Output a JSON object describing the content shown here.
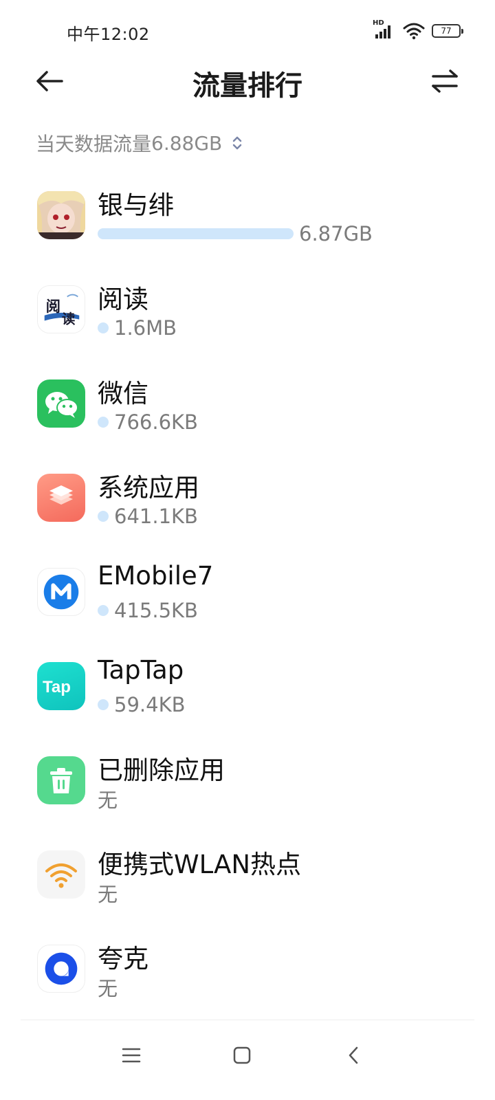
{
  "status_bar": {
    "time": "中午12:02",
    "network_label": "HD",
    "battery_level": "77",
    "signal_bars_of_4": 4,
    "wifi_connected": true
  },
  "header": {
    "title": "流量排行",
    "back_icon": "arrow-left-icon",
    "swap_icon": "swap-arrows-icon"
  },
  "summary": {
    "label": "当天数据流量",
    "value": "6.88GB",
    "chevron_icon": "chevron-up-down-icon"
  },
  "colors": {
    "usage_bar": "#cfe6fb",
    "secondary_text": "#7b7b7b",
    "title_text": "#1b1b1b"
  },
  "apps": [
    {
      "name": "银与绯",
      "usage": "6.87GB",
      "usage_fraction": 1.0,
      "icon": "anime-character-icon"
    },
    {
      "name": "阅读",
      "usage": "1.6MB",
      "usage_fraction": 0.0002,
      "icon": "read-app-icon"
    },
    {
      "name": "微信",
      "usage": "766.6KB",
      "usage_fraction": 0.0001,
      "icon": "wechat-icon"
    },
    {
      "name": "系统应用",
      "usage": "641.1KB",
      "usage_fraction": 0.0001,
      "icon": "system-apps-icon"
    },
    {
      "name": "EMobile7",
      "usage": "415.5KB",
      "usage_fraction": 0.0001,
      "icon": "emobile-icon"
    },
    {
      "name": "TapTap",
      "usage": "59.4KB",
      "usage_fraction": 0.0,
      "icon": "taptap-icon"
    },
    {
      "name": "已删除应用",
      "usage": "无",
      "usage_fraction": 0,
      "icon": "trash-icon"
    },
    {
      "name": "便携式WLAN热点",
      "usage": "无",
      "usage_fraction": 0,
      "icon": "hotspot-icon"
    },
    {
      "name": "夸克",
      "usage": "无",
      "usage_fraction": 0,
      "icon": "quark-icon"
    }
  ],
  "nav": {
    "menu_icon": "menu-icon",
    "home_icon": "home-icon",
    "back_icon": "back-chevron-icon"
  }
}
